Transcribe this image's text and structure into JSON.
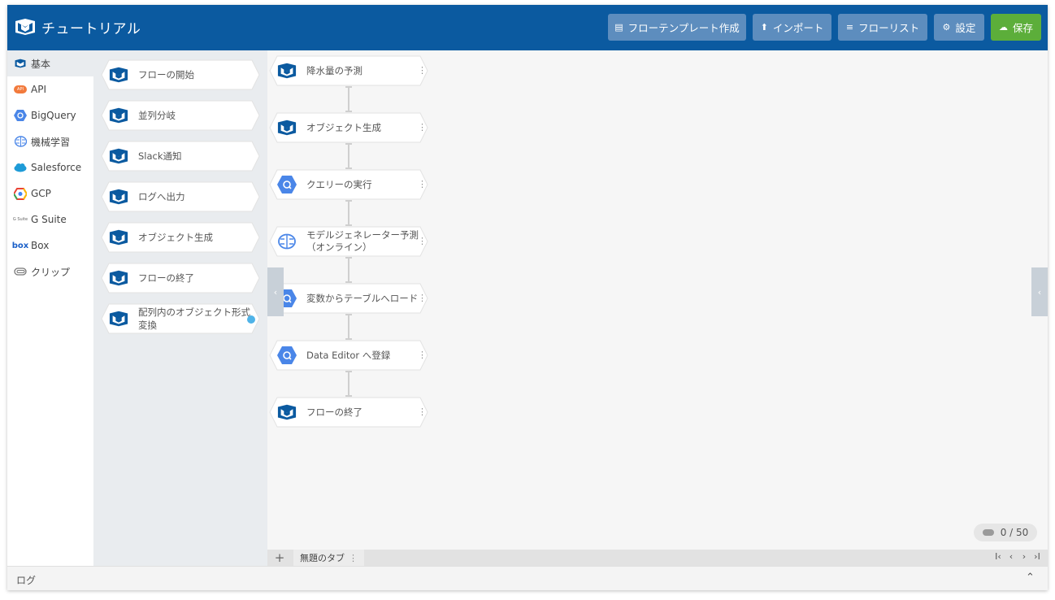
{
  "app": {
    "title": "チュートリアル"
  },
  "header_buttons": {
    "flow_template": "フローテンプレート作成",
    "import": "インポート",
    "flow_list": "フローリスト",
    "settings": "設定",
    "save": "保存"
  },
  "categories": [
    {
      "label": "基本",
      "icon": "flow-logo-icon"
    },
    {
      "label": "API",
      "icon": "api-icon"
    },
    {
      "label": "BigQuery",
      "icon": "bigquery-icon"
    },
    {
      "label": "機械学習",
      "icon": "brain-icon"
    },
    {
      "label": "Salesforce",
      "icon": "salesforce-cloud-icon"
    },
    {
      "label": "GCP",
      "icon": "gcp-icon"
    },
    {
      "label": "G Suite",
      "icon": "gsuite-icon"
    },
    {
      "label": "Box",
      "icon": "box-icon"
    },
    {
      "label": "クリップ",
      "icon": "paperclip-icon"
    }
  ],
  "category_badges": {
    "api": "API",
    "box": "box",
    "gsuite": "G Suite"
  },
  "palette": [
    {
      "label": "フローの開始"
    },
    {
      "label": "並列分岐"
    },
    {
      "label": "Slack通知"
    },
    {
      "label": "ログへ出力"
    },
    {
      "label": "オブジェクト生成"
    },
    {
      "label": "フローの終了"
    },
    {
      "label": "配列内のオブジェクト形式変換"
    }
  ],
  "flow": [
    {
      "label": "降水量の予測",
      "icon": "flow-logo-icon"
    },
    {
      "label": "オブジェクト生成",
      "icon": "flow-logo-icon"
    },
    {
      "label": "クエリーの実行",
      "icon": "bigquery-icon"
    },
    {
      "label": "モデルジェネレーター予測（オンライン）",
      "icon": "brain-icon"
    },
    {
      "label": "変数からテーブルへロード",
      "icon": "bigquery-icon"
    },
    {
      "label": "Data Editor へ登録",
      "icon": "bigquery-icon"
    },
    {
      "label": "フローの終了",
      "icon": "flow-logo-icon"
    }
  ],
  "node_menu": "⋮",
  "counter": {
    "text": "0 / 50"
  },
  "tabs": {
    "add": "+",
    "items": [
      {
        "label": "無題のタブ",
        "menu": "⋮"
      }
    ]
  },
  "tab_nav": {
    "first": "I‹",
    "prev": "‹",
    "next": "›",
    "last": "›I"
  },
  "side_toggles": {
    "left": "‹",
    "right": "‹"
  },
  "log": {
    "label": "ログ",
    "toggle": "⌃"
  },
  "colors": {
    "header": "#0b5aa0",
    "button": "#5d8dbe",
    "save": "#5cae3a",
    "bigquery": "#4a86e8",
    "logo": "#0b5aa0"
  }
}
